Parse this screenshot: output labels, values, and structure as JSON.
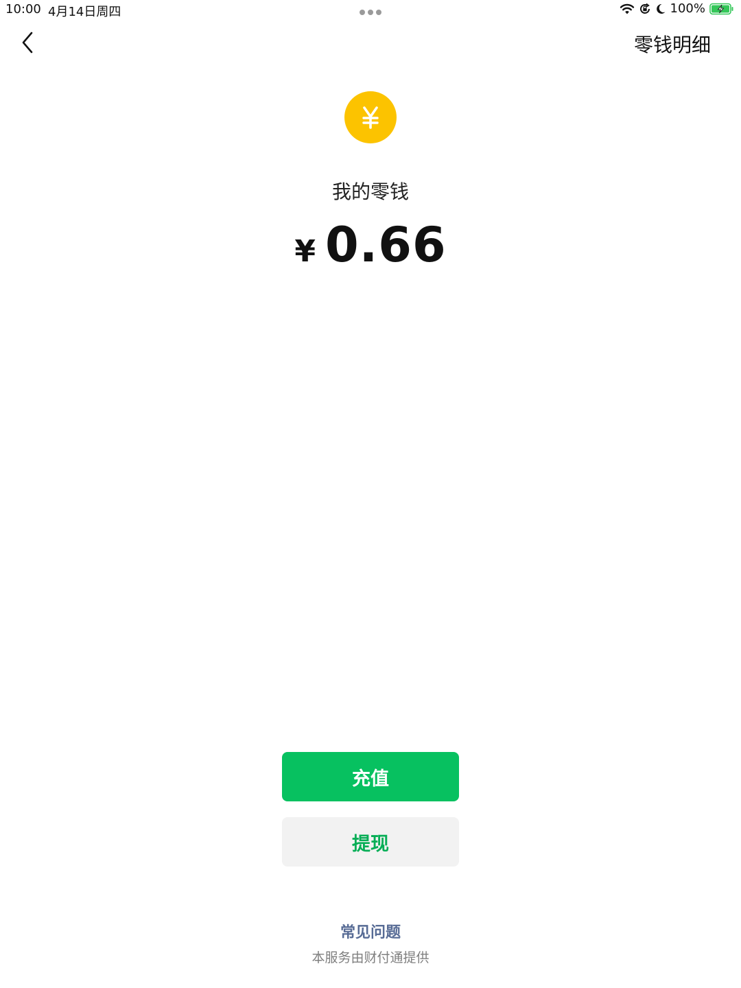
{
  "status_bar": {
    "time": "10:00",
    "date": "4月14日周四",
    "battery_percent": "100%",
    "battery_level": 1.0,
    "icons": [
      "wifi-icon",
      "rotation-lock-icon",
      "moon-icon",
      "battery-charging-icon"
    ]
  },
  "nav": {
    "back_icon": "chevron-left-icon",
    "detail_label": "零钱明细"
  },
  "balance": {
    "icon": "yuan-coin-icon",
    "icon_glyph": "¥",
    "title": "我的零钱",
    "currency": "¥",
    "amount": "0.66"
  },
  "actions": {
    "recharge_label": "充值",
    "withdraw_label": "提现"
  },
  "footer": {
    "faq_label": "常见问题",
    "provider_text": "本服务由财付通提供"
  },
  "colors": {
    "coin": "#fcc300",
    "primary_green": "#07c160",
    "withdraw_text": "#06ae56",
    "withdraw_bg": "#f2f2f2",
    "link_blue": "#576b95",
    "battery_green": "#34c759"
  }
}
